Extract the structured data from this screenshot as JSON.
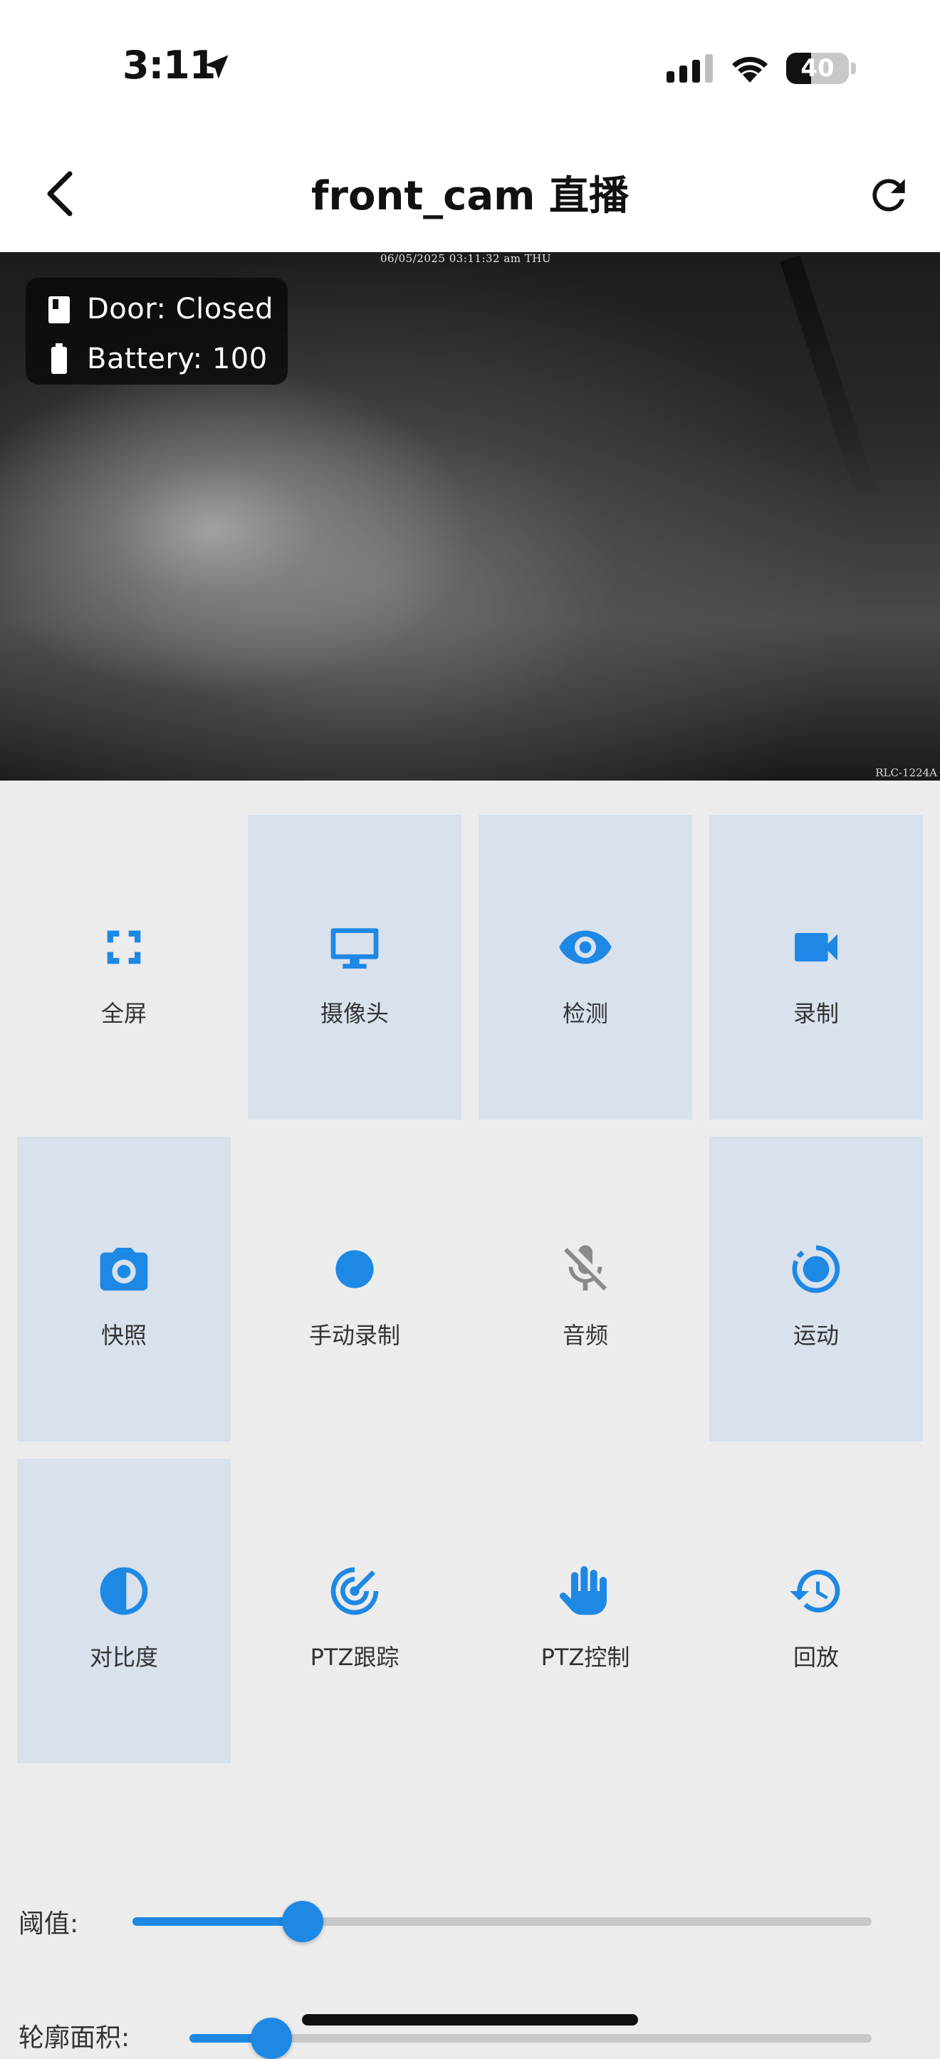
{
  "status_bar": {
    "time": "3:11",
    "battery_level": "40",
    "battery_fraction": 0.4
  },
  "nav": {
    "title": "front_cam 直播",
    "back_icon": "chevron-left-icon",
    "refresh_icon": "refresh-icon"
  },
  "feed": {
    "timestamp": "06/05/2025 03:11:32 am THU",
    "model": "RLC-1224A",
    "door_status": "Door: Closed",
    "battery_status": "Battery: 100"
  },
  "controls": [
    {
      "label": "全屏",
      "icon": "fullscreen-icon",
      "active": false
    },
    {
      "label": "摄像头",
      "icon": "monitor-icon",
      "active": true
    },
    {
      "label": "检测",
      "icon": "eye-icon",
      "active": true
    },
    {
      "label": "录制",
      "icon": "videocam-icon",
      "active": true
    },
    {
      "label": "快照",
      "icon": "camera-icon",
      "active": true
    },
    {
      "label": "手动录制",
      "icon": "record-dot-icon",
      "active": false
    },
    {
      "label": "音频",
      "icon": "mic-off-icon",
      "active": false
    },
    {
      "label": "运动",
      "icon": "motion-icon",
      "active": true
    },
    {
      "label": "对比度",
      "icon": "contrast-icon",
      "active": true
    },
    {
      "label": "PTZ跟踪",
      "icon": "ptz-tracking-icon",
      "active": false
    },
    {
      "label": "PTZ控制",
      "icon": "hand-icon",
      "active": false
    },
    {
      "label": "回放",
      "icon": "history-icon",
      "active": false
    }
  ],
  "sliders": {
    "threshold": {
      "label": "阈值:",
      "value": 0.23
    },
    "contour_area": {
      "label": "轮廓面积:",
      "value": 0.12
    }
  },
  "colors": {
    "accent": "#1e88e5",
    "active_tile": "#d8e1ec",
    "background": "#ececec"
  }
}
